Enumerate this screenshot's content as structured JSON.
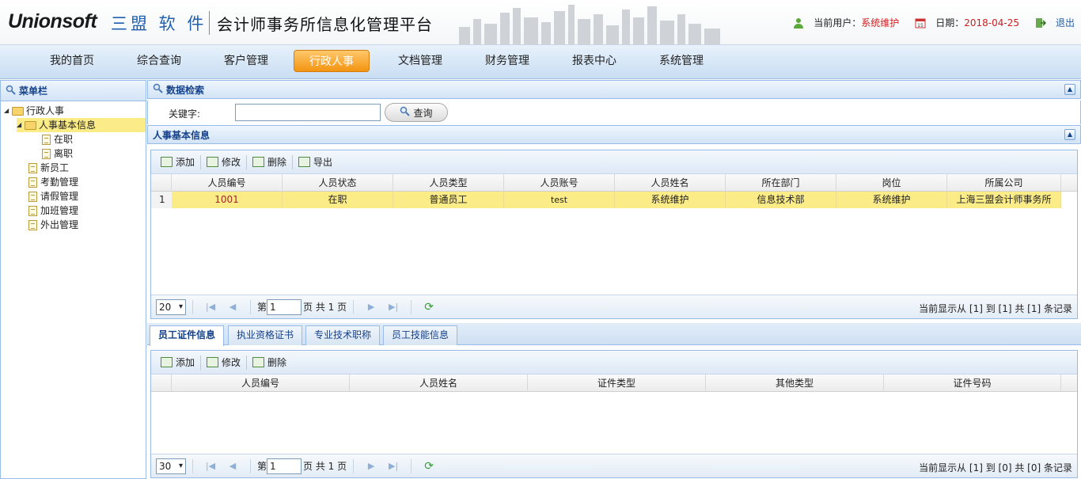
{
  "header": {
    "logo_en": "Unionsoft",
    "logo_cn": "三盟 软 件",
    "platform_title": "会计师事务所信息化管理平台",
    "current_user_label": "当前用户：",
    "current_user": "系统维护",
    "date_label": "日期：",
    "date": "2018-04-25",
    "logout": "退出"
  },
  "nav": {
    "items": [
      "我的首页",
      "综合查询",
      "客户管理",
      "行政人事",
      "文档管理",
      "财务管理",
      "报表中心",
      "系统管理"
    ],
    "active": "行政人事"
  },
  "sidebar": {
    "title": "菜单栏",
    "tree": [
      {
        "label": "行政人事",
        "type": "folder",
        "expanded": true
      },
      {
        "label": "人事基本信息",
        "type": "folder",
        "expanded": true,
        "selected": true
      },
      {
        "label": "在职",
        "type": "file"
      },
      {
        "label": "离职",
        "type": "file"
      },
      {
        "label": "新员工",
        "type": "file"
      },
      {
        "label": "考勤管理",
        "type": "file"
      },
      {
        "label": "请假管理",
        "type": "file"
      },
      {
        "label": "加班管理",
        "type": "file"
      },
      {
        "label": "外出管理",
        "type": "file"
      }
    ]
  },
  "search": {
    "title": "数据检索",
    "keyword_label": "关键字:",
    "keyword_value": "",
    "button": "查询"
  },
  "personnel": {
    "title": "人事基本信息",
    "toolbar": [
      "添加",
      "修改",
      "删除",
      "导出"
    ],
    "columns": [
      "人员编号",
      "人员状态",
      "人员类型",
      "人员账号",
      "人员姓名",
      "所在部门",
      "岗位",
      "所属公司"
    ],
    "rows": [
      {
        "num": "1",
        "cells": [
          "1001",
          "在职",
          "普通员工",
          "test",
          "系统维护",
          "信息技术部",
          "系统维护",
          "上海三盟会计师事务所"
        ]
      }
    ],
    "pager": {
      "page_size": "20",
      "page_prefix": "第",
      "page_value": "1",
      "page_suffix": "页 共 1 页",
      "info": "当前显示从 [1] 到 [1] 共 [1] 条记录"
    }
  },
  "detail_tabs": {
    "tabs": [
      "员工证件信息",
      "执业资格证书",
      "专业技术职称",
      "员工技能信息"
    ],
    "active": "员工证件信息"
  },
  "certificates": {
    "toolbar": [
      "添加",
      "修改",
      "删除"
    ],
    "columns": [
      "人员编号",
      "人员姓名",
      "证件类型",
      "其他类型",
      "证件号码"
    ],
    "rows": [],
    "pager": {
      "page_size": "30",
      "page_prefix": "第",
      "page_value": "1",
      "page_suffix": "页 共 1 页",
      "info": "当前显示从 [1] 到 [0] 共 [0] 条记录"
    }
  },
  "colors": {
    "accent_orange": "#f39412",
    "panel_blue": "#15428b",
    "highlight_row": "#fbec88",
    "user_red": "#d21d1d"
  }
}
